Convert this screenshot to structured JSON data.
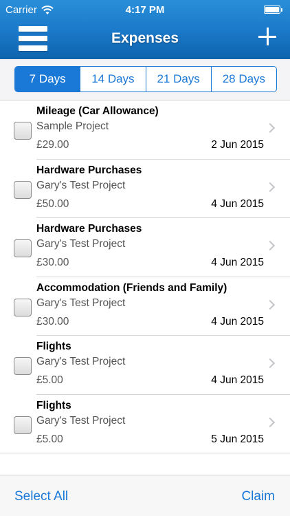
{
  "status_bar": {
    "carrier": "Carrier",
    "time": "4:17 PM",
    "battery_level": 1.0
  },
  "nav": {
    "title": "Expenses",
    "left_icon": "menu-icon",
    "right_icon": "add-icon"
  },
  "periods": {
    "options": [
      "7 Days",
      "14 Days",
      "21 Days",
      "28 Days"
    ],
    "selected": "7 Days"
  },
  "expenses": [
    {
      "title": "Mileage (Car Allowance)",
      "project": "Sample Project",
      "amount": "£29.00",
      "date": "2 Jun 2015"
    },
    {
      "title": "Hardware Purchases",
      "project": "Gary's Test Project",
      "amount": "£50.00",
      "date": "4 Jun 2015"
    },
    {
      "title": "Hardware Purchases",
      "project": "Gary's Test Project",
      "amount": "£30.00",
      "date": "4 Jun 2015"
    },
    {
      "title": "Accommodation (Friends and Family)",
      "project": "Gary's Test Project",
      "amount": "£30.00",
      "date": "4 Jun 2015"
    },
    {
      "title": "Flights",
      "project": "Gary's Test Project",
      "amount": "£5.00",
      "date": "4 Jun 2015"
    },
    {
      "title": "Flights",
      "project": "Gary's Test Project",
      "amount": "£5.00",
      "date": "5 Jun 2015"
    }
  ],
  "toolbar": {
    "select_all_label": "Select All",
    "claim_label": "Claim"
  },
  "colors": {
    "accent": "#1a78d6",
    "header_top": "#2a8fd9",
    "header_bottom": "#0f63ad"
  }
}
